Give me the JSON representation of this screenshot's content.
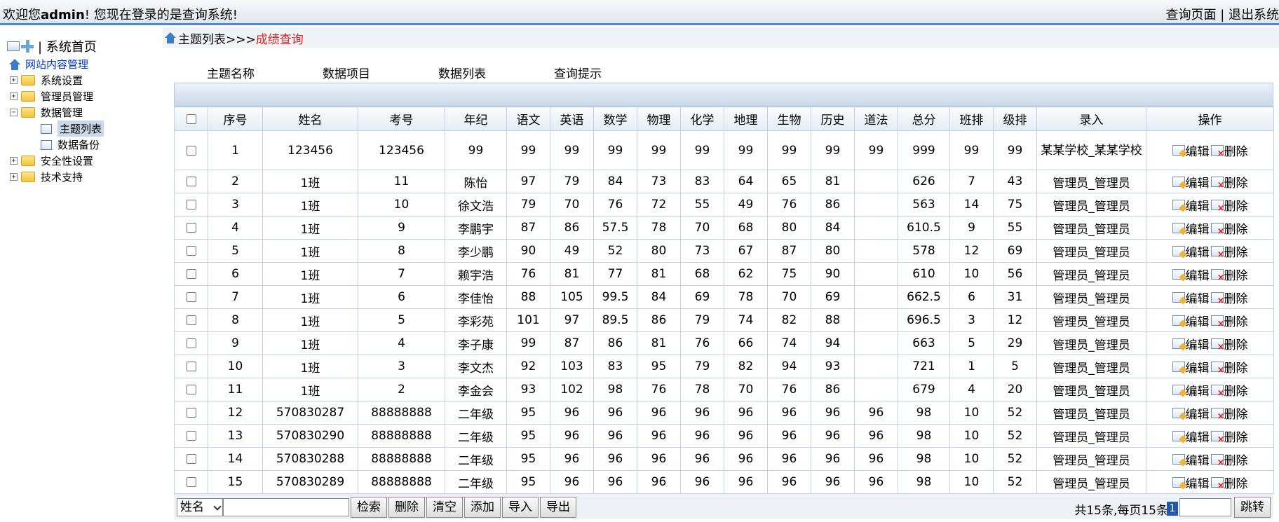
{
  "header": {
    "welcome_prefix": "欢迎您",
    "user": "admin",
    "welcome_suffix": "! 您现在登录的是查询系统!",
    "links": "查询页面 | 退出系统"
  },
  "sidebar": {
    "home": "| 系统首页",
    "root": "网站内容管理",
    "items": [
      {
        "label": "系统设置"
      },
      {
        "label": "管理员管理"
      },
      {
        "label": "数据管理"
      },
      {
        "label": "安全性设置"
      },
      {
        "label": "技术支持"
      }
    ],
    "children": [
      {
        "label": "主题列表"
      },
      {
        "label": "数据备份"
      }
    ]
  },
  "breadcrumb": {
    "path": "主题列表>>>",
    "current": "成绩查询"
  },
  "tabs": [
    "主题名称",
    "数据项目",
    "数据列表",
    "查询提示"
  ],
  "table": {
    "columns": [
      "序号",
      "姓名",
      "考号",
      "年纪",
      "语文",
      "英语",
      "数学",
      "物理",
      "化学",
      "地理",
      "生物",
      "历史",
      "道法",
      "总分",
      "班排",
      "级排",
      "录入",
      "操作"
    ],
    "edit_label": "编辑",
    "delete_label": "删除",
    "rows": [
      [
        "1",
        "123456",
        "123456",
        "99",
        "99",
        "99",
        "99",
        "99",
        "99",
        "99",
        "99",
        "99",
        "99",
        "999",
        "99",
        "99",
        "某某学校_某某学校"
      ],
      [
        "2",
        "1班",
        "11",
        "陈怡",
        "97",
        "79",
        "84",
        "73",
        "83",
        "64",
        "65",
        "81",
        "",
        "626",
        "7",
        "43",
        "管理员_管理员"
      ],
      [
        "3",
        "1班",
        "10",
        "徐文浩",
        "79",
        "70",
        "76",
        "72",
        "55",
        "49",
        "76",
        "86",
        "",
        "563",
        "14",
        "75",
        "管理员_管理员"
      ],
      [
        "4",
        "1班",
        "9",
        "李鹏宇",
        "87",
        "86",
        "57.5",
        "78",
        "70",
        "68",
        "80",
        "84",
        "",
        "610.5",
        "9",
        "55",
        "管理员_管理员"
      ],
      [
        "5",
        "1班",
        "8",
        "李少鹏",
        "90",
        "49",
        "52",
        "80",
        "73",
        "67",
        "87",
        "80",
        "",
        "578",
        "12",
        "69",
        "管理员_管理员"
      ],
      [
        "6",
        "1班",
        "7",
        "赖宇浩",
        "76",
        "81",
        "77",
        "81",
        "68",
        "62",
        "75",
        "90",
        "",
        "610",
        "10",
        "56",
        "管理员_管理员"
      ],
      [
        "7",
        "1班",
        "6",
        "李佳怡",
        "88",
        "105",
        "99.5",
        "84",
        "69",
        "78",
        "70",
        "69",
        "",
        "662.5",
        "6",
        "31",
        "管理员_管理员"
      ],
      [
        "8",
        "1班",
        "5",
        "李彩苑",
        "101",
        "97",
        "89.5",
        "86",
        "79",
        "74",
        "82",
        "88",
        "",
        "696.5",
        "3",
        "12",
        "管理员_管理员"
      ],
      [
        "9",
        "1班",
        "4",
        "李子康",
        "99",
        "87",
        "86",
        "81",
        "76",
        "66",
        "74",
        "94",
        "",
        "663",
        "5",
        "29",
        "管理员_管理员"
      ],
      [
        "10",
        "1班",
        "3",
        "李文杰",
        "92",
        "103",
        "83",
        "95",
        "79",
        "82",
        "94",
        "93",
        "",
        "721",
        "1",
        "5",
        "管理员_管理员"
      ],
      [
        "11",
        "1班",
        "2",
        "李金会",
        "93",
        "102",
        "98",
        "76",
        "78",
        "70",
        "76",
        "86",
        "",
        "679",
        "4",
        "20",
        "管理员_管理员"
      ],
      [
        "12",
        "570830287",
        "88888888",
        "二年级",
        "95",
        "96",
        "96",
        "96",
        "96",
        "96",
        "96",
        "96",
        "96",
        "98",
        "10",
        "52",
        "管理员_管理员"
      ],
      [
        "13",
        "570830290",
        "88888888",
        "二年级",
        "95",
        "96",
        "96",
        "96",
        "96",
        "96",
        "96",
        "96",
        "96",
        "98",
        "10",
        "52",
        "管理员_管理员"
      ],
      [
        "14",
        "570830288",
        "88888888",
        "二年级",
        "95",
        "96",
        "96",
        "96",
        "96",
        "96",
        "96",
        "96",
        "96",
        "98",
        "10",
        "52",
        "管理员_管理员"
      ],
      [
        "15",
        "570830289",
        "88888888",
        "二年级",
        "95",
        "96",
        "96",
        "96",
        "96",
        "96",
        "96",
        "96",
        "96",
        "98",
        "10",
        "52",
        "管理员_管理员"
      ]
    ]
  },
  "footer": {
    "field_select": "姓名",
    "search_value": "",
    "buttons": [
      "检索",
      "删除",
      "清空",
      "添加",
      "导入",
      "导出"
    ],
    "info": "共15条,每页15条",
    "current_page": "1",
    "page_input": "",
    "jump": "跳转"
  }
}
